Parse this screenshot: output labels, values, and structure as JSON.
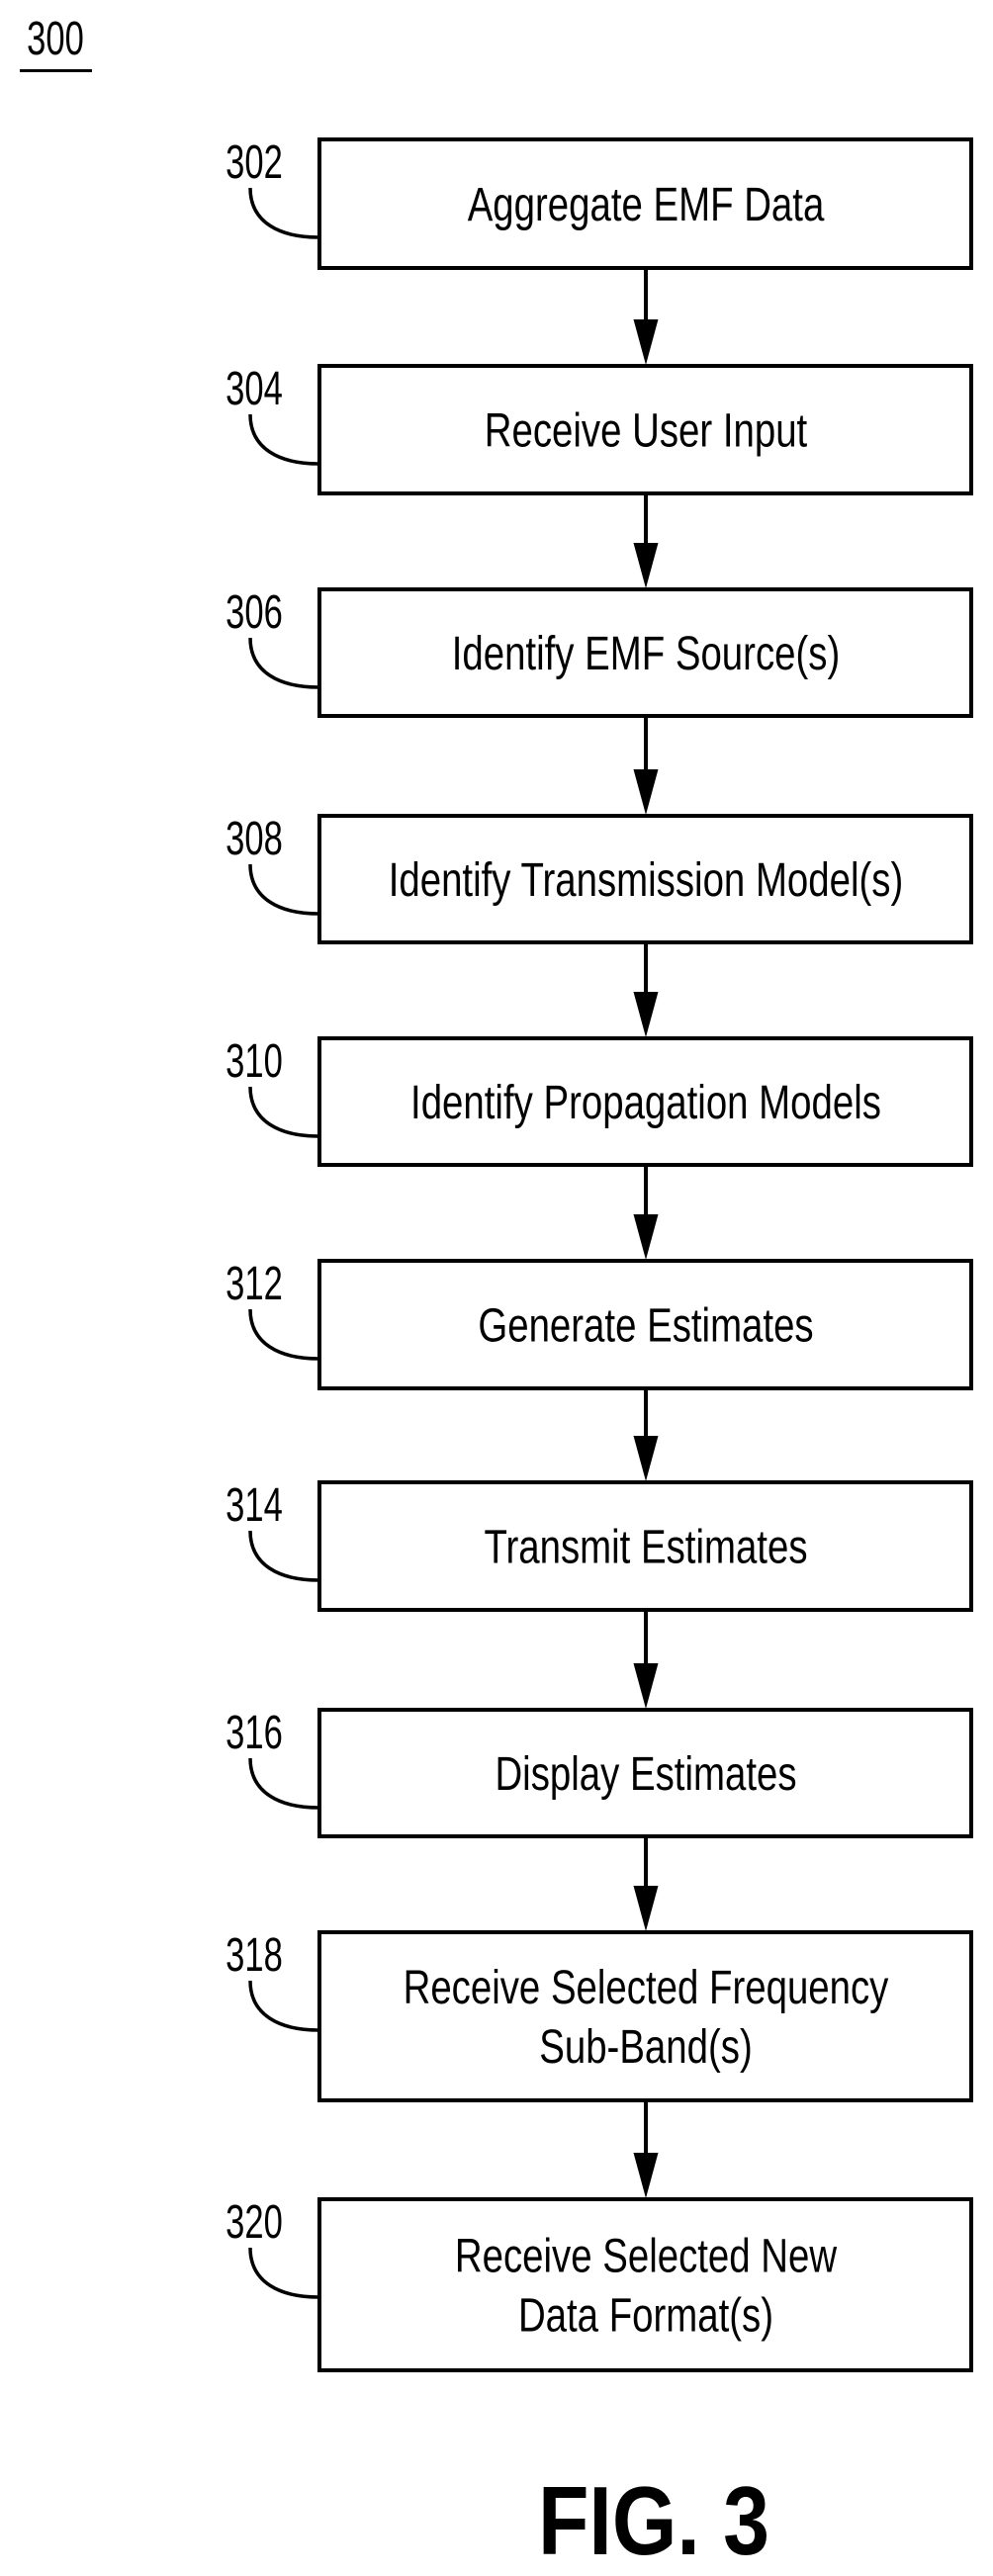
{
  "figure": {
    "number_label": "300",
    "caption": "FIG. 3",
    "colors": {
      "ink": "#000000",
      "background": "#ffffff"
    }
  },
  "flowchart": {
    "steps": [
      {
        "ref": "302",
        "lines": [
          "Aggregate EMF Data"
        ]
      },
      {
        "ref": "304",
        "lines": [
          "Receive User Input"
        ]
      },
      {
        "ref": "306",
        "lines": [
          "Identify EMF Source(s)"
        ]
      },
      {
        "ref": "308",
        "lines": [
          "Identify Transmission Model(s)"
        ]
      },
      {
        "ref": "310",
        "lines": [
          "Identify Propagation Models"
        ]
      },
      {
        "ref": "312",
        "lines": [
          "Generate Estimates"
        ]
      },
      {
        "ref": "314",
        "lines": [
          "Transmit Estimates"
        ]
      },
      {
        "ref": "316",
        "lines": [
          "Display Estimates"
        ]
      },
      {
        "ref": "318",
        "lines": [
          "Receive Selected Frequency",
          "Sub-Band(s)"
        ]
      },
      {
        "ref": "320",
        "lines": [
          "Receive Selected New",
          "Data Format(s)"
        ]
      }
    ],
    "connectors": [
      {
        "from": "302",
        "to": "304"
      },
      {
        "from": "304",
        "to": "306"
      },
      {
        "from": "306",
        "to": "308"
      },
      {
        "from": "308",
        "to": "310"
      },
      {
        "from": "310",
        "to": "312"
      },
      {
        "from": "312",
        "to": "314"
      },
      {
        "from": "314",
        "to": "316"
      },
      {
        "from": "316",
        "to": "318"
      },
      {
        "from": "318",
        "to": "320"
      }
    ]
  }
}
